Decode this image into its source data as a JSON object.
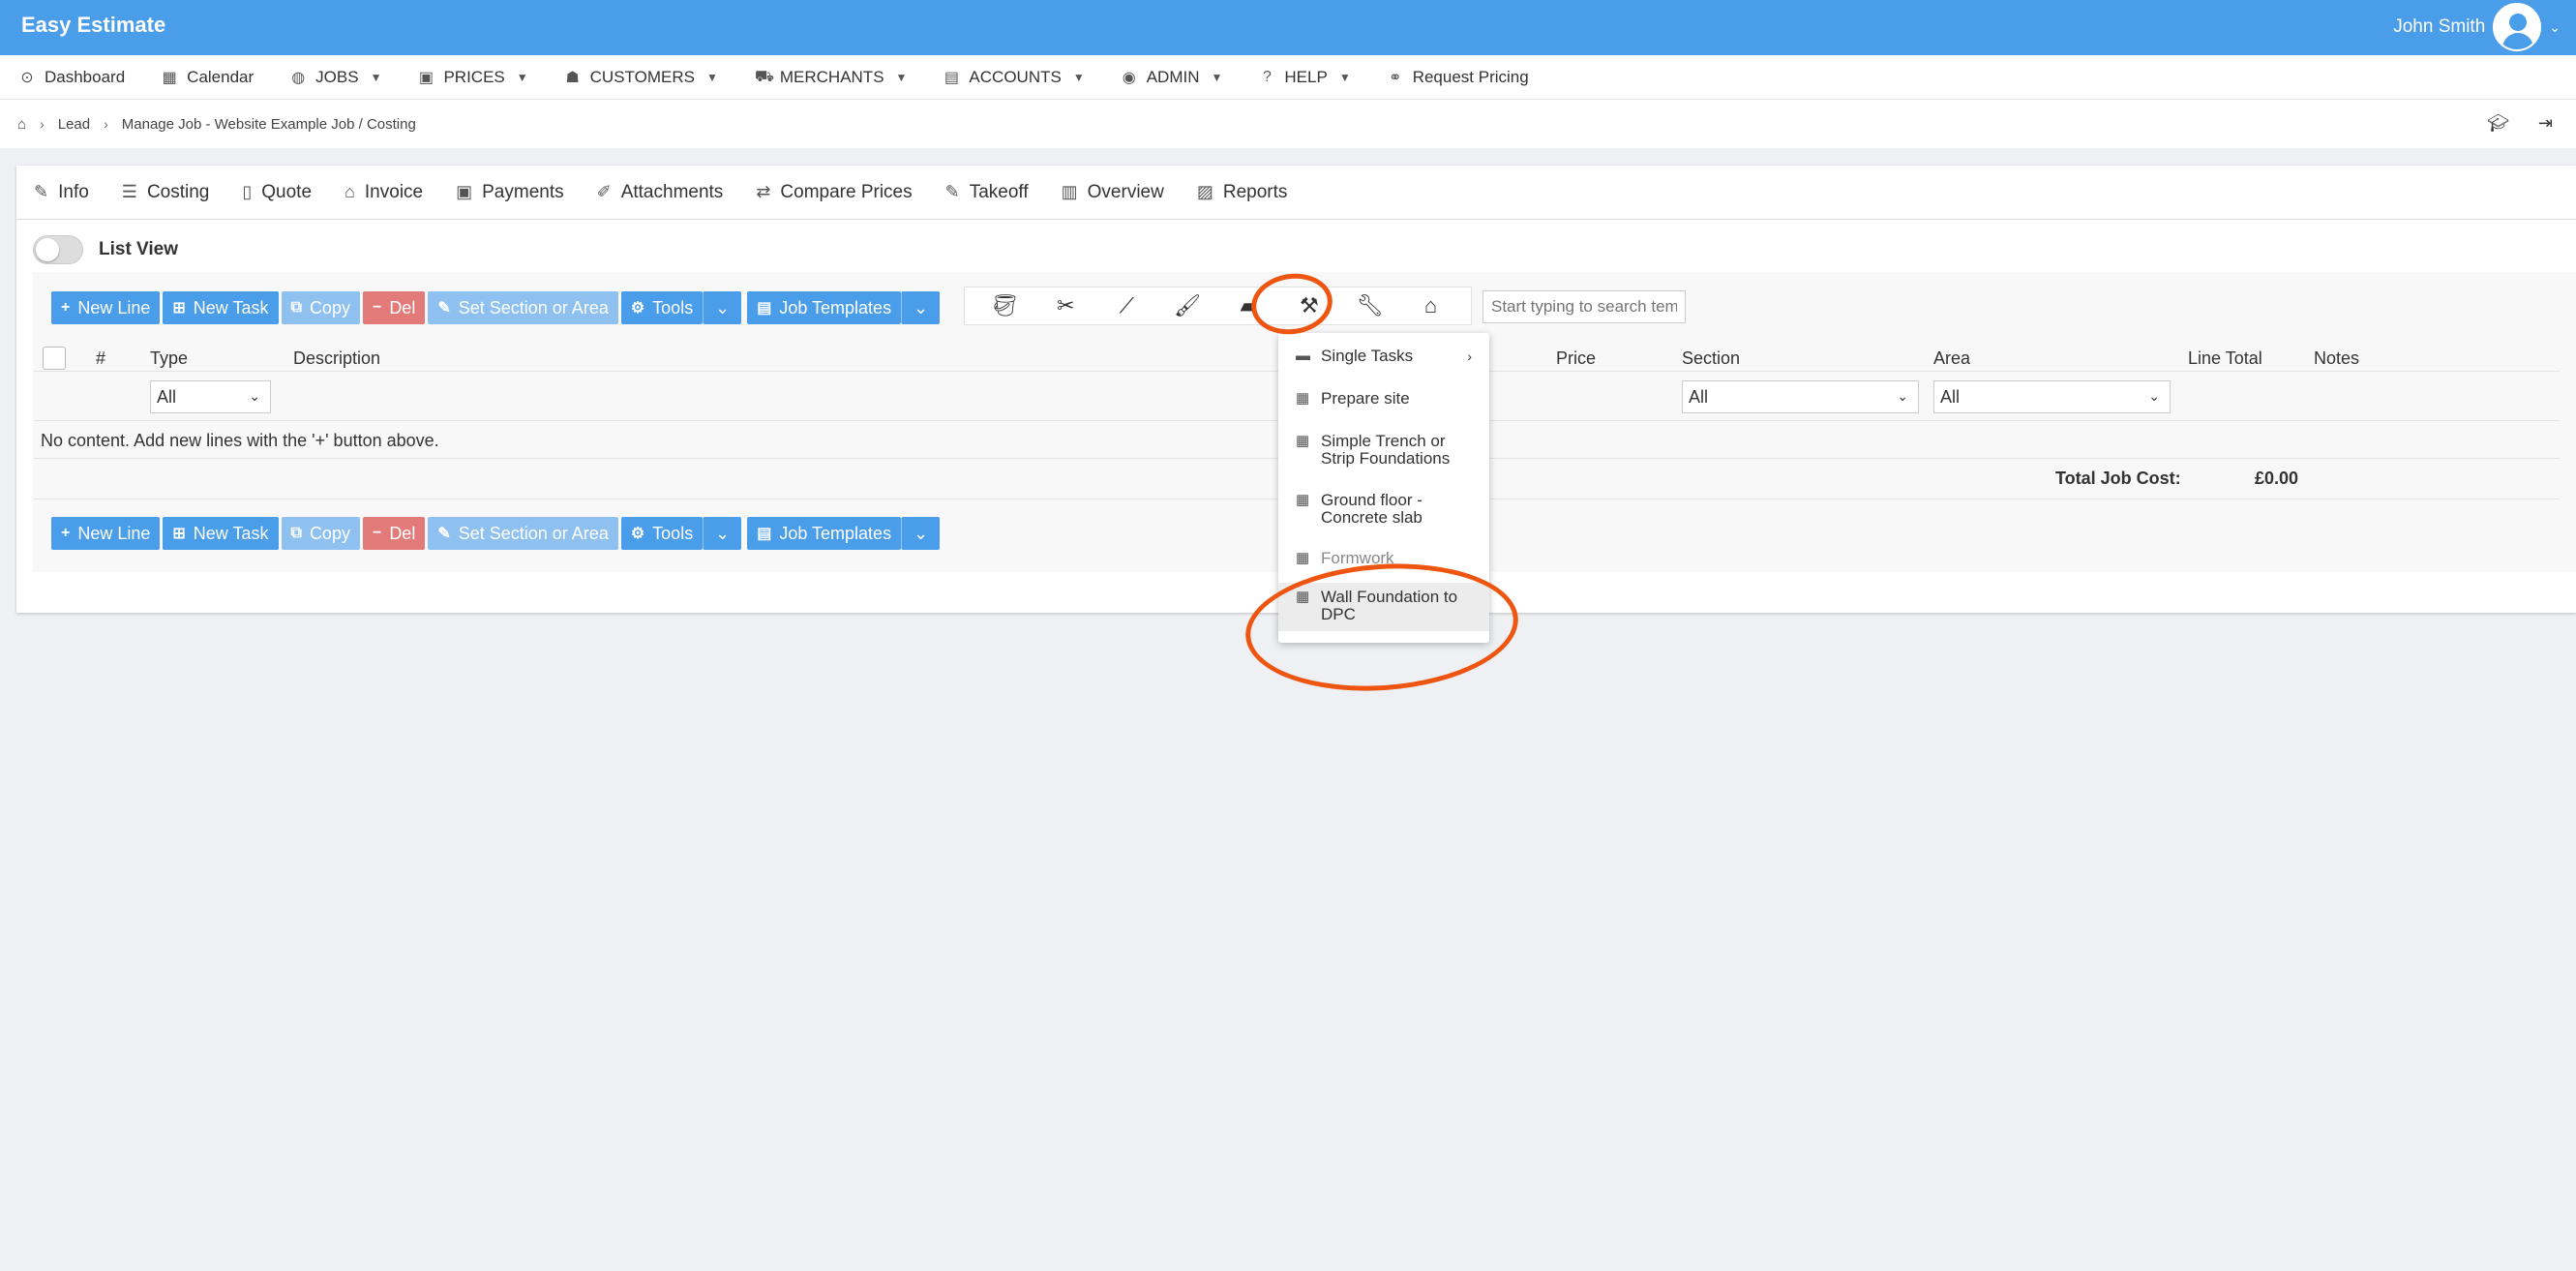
{
  "app": {
    "title": "Easy Estimate",
    "user_name": "John Smith"
  },
  "nav": {
    "items": [
      {
        "label": "Dashboard",
        "icon": "dashboard-icon",
        "glyph": "⊙",
        "dropdown": false
      },
      {
        "label": "Calendar",
        "icon": "calendar-icon",
        "glyph": "▦",
        "dropdown": false
      },
      {
        "label": "JOBS",
        "icon": "globe-icon",
        "glyph": "◍",
        "dropdown": true
      },
      {
        "label": "PRICES",
        "icon": "money-icon",
        "glyph": "▣",
        "dropdown": true
      },
      {
        "label": "CUSTOMERS",
        "icon": "users-icon",
        "glyph": "☗",
        "dropdown": true
      },
      {
        "label": "MERCHANTS",
        "icon": "cart-icon",
        "glyph": "⛟",
        "dropdown": true
      },
      {
        "label": "ACCOUNTS",
        "icon": "accounts-icon",
        "glyph": "▤",
        "dropdown": true
      },
      {
        "label": "ADMIN",
        "icon": "user-circle-icon",
        "glyph": "◉",
        "dropdown": true
      },
      {
        "label": "HELP",
        "icon": "question-icon",
        "glyph": "?",
        "dropdown": true
      },
      {
        "label": "Request Pricing",
        "icon": "handshake-icon",
        "glyph": "⚭",
        "dropdown": false
      }
    ]
  },
  "breadcrumb": {
    "items": [
      "Lead",
      "Manage Job - Website Example Job / Costing"
    ]
  },
  "tabs": [
    {
      "label": "Info",
      "glyph": "✎"
    },
    {
      "label": "Costing",
      "glyph": "☰"
    },
    {
      "label": "Quote",
      "glyph": "▯"
    },
    {
      "label": "Invoice",
      "glyph": "⌂"
    },
    {
      "label": "Payments",
      "glyph": "▣"
    },
    {
      "label": "Attachments",
      "glyph": "✐"
    },
    {
      "label": "Compare Prices",
      "glyph": "⇄"
    },
    {
      "label": "Takeoff",
      "glyph": "✎"
    },
    {
      "label": "Overview",
      "glyph": "▥"
    },
    {
      "label": "Reports",
      "glyph": "▨"
    }
  ],
  "list_view": {
    "label": "List View",
    "enabled": false
  },
  "toolbar": {
    "new_line": "New Line",
    "new_task": "New Task",
    "copy": "Copy",
    "del": "Del",
    "set_section": "Set Section or Area",
    "tools": "Tools",
    "job_templates": "Job Templates",
    "search_placeholder": "Start typing to search tem"
  },
  "tool_icons": [
    "trowel",
    "pliers",
    "screwdriver",
    "paintbrush",
    "brick",
    "roller",
    "wrench",
    "house"
  ],
  "table": {
    "headers": {
      "num": "#",
      "type": "Type",
      "description": "Description",
      "price": "Price",
      "section": "Section",
      "area": "Area",
      "line_total": "Line Total",
      "notes": "Notes"
    },
    "filters": {
      "type": "All",
      "section": "All",
      "area": "All"
    },
    "empty_message": "No content. Add new lines with the '+' button above.",
    "total_label": "Total Job Cost:",
    "total_value": "£0.00"
  },
  "dropdown": {
    "items": [
      {
        "label": "Single Tasks",
        "kind": "folder"
      },
      {
        "label": "Prepare site",
        "kind": "template"
      },
      {
        "label": "Simple Trench or Strip Foundations",
        "kind": "template"
      },
      {
        "label": "Ground floor - Concrete slab",
        "kind": "template"
      },
      {
        "label": "Formwork",
        "kind": "template"
      },
      {
        "label": "Wall Foundation to DPC",
        "kind": "template"
      }
    ]
  },
  "colors": {
    "primary": "#4a9de8",
    "annotation": "#ee5511",
    "danger": "#e37a7a"
  }
}
